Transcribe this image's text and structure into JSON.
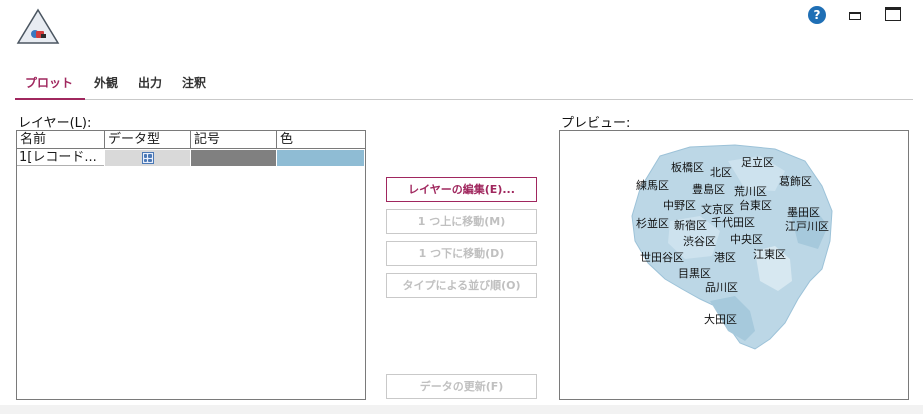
{
  "header": {
    "help_icon_glyph": "?",
    "icons": [
      "app-logo-icon",
      "help-icon",
      "minimize-icon",
      "maximize-icon"
    ]
  },
  "tabs": [
    {
      "label": "プロット",
      "active": true
    },
    {
      "label": "外観",
      "active": false
    },
    {
      "label": "出力",
      "active": false
    },
    {
      "label": "注釈",
      "active": false
    }
  ],
  "layers": {
    "label": "レイヤー(L):",
    "columns": [
      "名前",
      "データ型",
      "記号",
      "色"
    ],
    "rows": [
      {
        "name": "1[レコード...",
        "type_icon": "grid-icon",
        "symbol_color": "#808080",
        "color": "#8fbcd4"
      }
    ]
  },
  "buttons": {
    "edit_layer": "レイヤーの編集(E)...",
    "move_up": "1 つ上に移動(M)",
    "move_down": "1 つ下に移動(D)",
    "sort_by_type": "タイプによる並び順(O)",
    "refresh_data": "データの更新(F)"
  },
  "preview": {
    "label": "プレビュー:",
    "map_color": "#8fbcd4",
    "wards": [
      "板橋区",
      "北区",
      "足立区",
      "練馬区",
      "豊島区",
      "荒川区",
      "葛飾区",
      "中野区",
      "文京区",
      "台東区",
      "墨田区",
      "杉並区",
      "新宿区",
      "千代田区",
      "江戸川区",
      "渋谷区",
      "中央区",
      "世田谷区",
      "港区",
      "江東区",
      "目黒区",
      "品川区",
      "大田区"
    ]
  },
  "colors": {
    "accent": "#a0275e",
    "help_blue": "#1f6fb5",
    "disabled_text": "#c0c0c0"
  }
}
